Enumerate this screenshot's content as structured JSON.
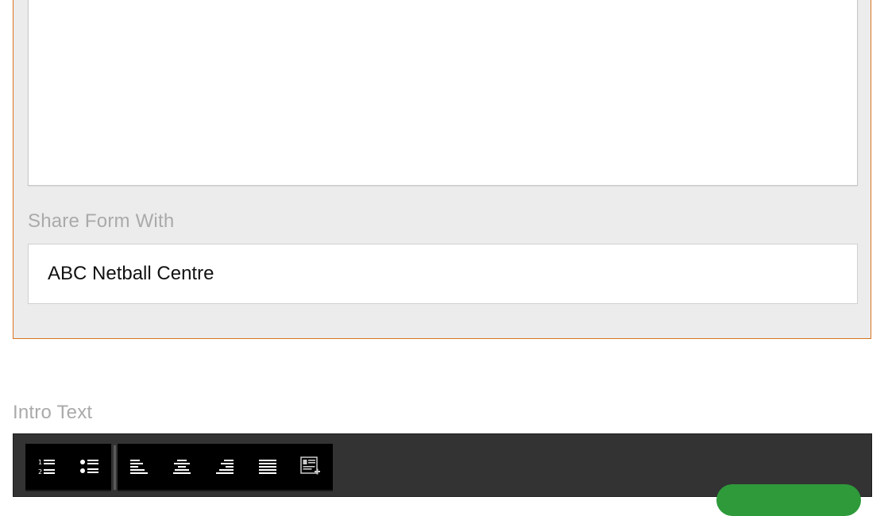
{
  "share": {
    "label": "Share Form With",
    "value": "ABC Netball Centre"
  },
  "intro": {
    "label": "Intro Text"
  },
  "toolbar": {
    "groups": [
      [
        "ordered-list-icon",
        "unordered-list-icon"
      ],
      [
        "align-left-icon",
        "align-center-icon",
        "align-right-icon",
        "align-justify-icon",
        "insert-template-icon"
      ]
    ]
  },
  "colors": {
    "panel_border": "#d7741f",
    "panel_bg": "#ececec",
    "label": "#aaaaaa",
    "toolbar_bg": "#333333",
    "button_green": "#2e9a3a"
  }
}
